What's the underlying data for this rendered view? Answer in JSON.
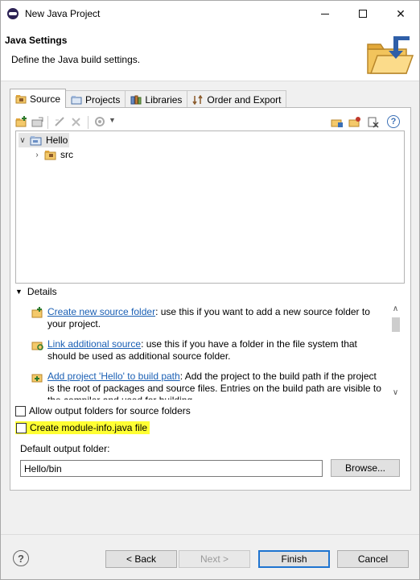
{
  "window": {
    "title": "New Java Project",
    "controls": {
      "minimize": "—",
      "maximize": "□",
      "close": "✕"
    }
  },
  "header": {
    "title": "Java Settings",
    "description": "Define the Java build settings."
  },
  "tabs": [
    {
      "label": "Source",
      "icon": "source-folder-icon",
      "active": true
    },
    {
      "label": "Projects",
      "icon": "projects-icon",
      "active": false
    },
    {
      "label": "Libraries",
      "icon": "libraries-icon",
      "active": false
    },
    {
      "label": "Order and Export",
      "icon": "order-export-icon",
      "active": false
    }
  ],
  "tree": {
    "project": "Hello",
    "child": "src",
    "expanded_glyph": "∨",
    "collapsed_glyph": "›"
  },
  "details": {
    "label": "Details",
    "items": [
      {
        "link": "Create new source folder",
        "text": ": use this if you want to add a new source folder to your project."
      },
      {
        "link": "Link additional source",
        "text": ": use this if you have a folder in the file system that should be used as additional source folder."
      },
      {
        "link": "Add project 'Hello' to build path",
        "text": ": Add the project to the build path if the project is the root of packages and source files. Entries on the build path are visible to the compiler and used for building."
      }
    ]
  },
  "options": {
    "allow_output_folders": "Allow output folders for source folders",
    "allow_output_folders_checked": false,
    "create_module_info": "Create module-info.java file",
    "create_module_info_checked": false,
    "highlight_color": "#ffff33"
  },
  "output": {
    "label": "Default output folder:",
    "value": "Hello/bin",
    "browse_label": "Browse..."
  },
  "footer": {
    "help": "?",
    "back": "< Back",
    "next": "Next >",
    "finish": "Finish",
    "cancel": "Cancel"
  },
  "colors": {
    "link": "#1a5fb4",
    "default_button_border": "#1e74d0"
  }
}
